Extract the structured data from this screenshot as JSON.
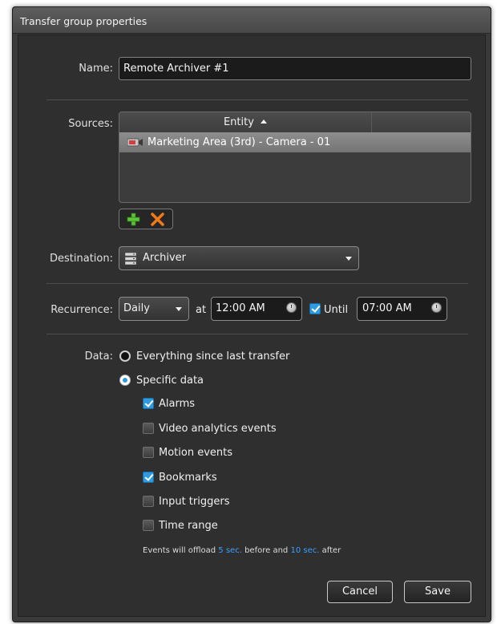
{
  "dialog": {
    "title": "Transfer group properties"
  },
  "name": {
    "label": "Name:",
    "value": "Remote Archiver #1"
  },
  "sources": {
    "label": "Sources:",
    "column_header": "Entity",
    "sort_icon": "sort-ascending-icon",
    "rows": [
      {
        "icon": "camera-icon",
        "label": "Marketing Area (3rd) - Camera - 01"
      }
    ],
    "add_icon": "plus-icon",
    "remove_icon": "x-icon"
  },
  "destination": {
    "label": "Destination:",
    "icon": "server-icon",
    "value": "Archiver"
  },
  "recurrence": {
    "label": "Recurrence:",
    "value": "Daily",
    "at_label": "at",
    "start_time": "12:00 AM",
    "until_checked": true,
    "until_label": "Until",
    "end_time": "07:00 AM"
  },
  "data": {
    "label": "Data:",
    "option_everything": "Everything since last transfer",
    "option_specific": "Specific data",
    "selected": "specific",
    "items": [
      {
        "label": "Alarms",
        "checked": true
      },
      {
        "label": "Video analytics events",
        "checked": false
      },
      {
        "label": "Motion events",
        "checked": false
      },
      {
        "label": "Bookmarks",
        "checked": true
      },
      {
        "label": "Input triggers",
        "checked": false
      },
      {
        "label": "Time range",
        "checked": false
      }
    ],
    "note": {
      "prefix": "Events will offload",
      "before_value": "5 sec.",
      "middle": "before and",
      "after_value": "10 sec.",
      "suffix": "after"
    }
  },
  "footer": {
    "cancel_label": "Cancel",
    "save_label": "Save"
  },
  "colors": {
    "accent": "#2e9ae0",
    "highlight_text": "#3aa0ff"
  }
}
